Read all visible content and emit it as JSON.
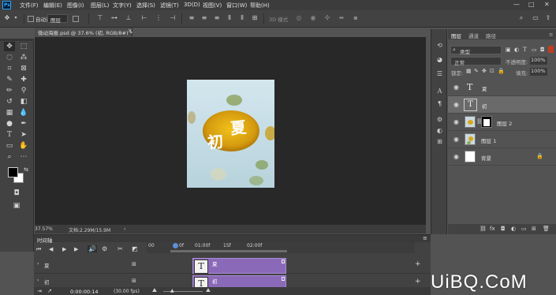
{
  "app": {
    "logo": "Ps"
  },
  "menu": [
    "文件(F)",
    "编辑(E)",
    "图像(I)",
    "图层(L)",
    "文字(Y)",
    "选择(S)",
    "滤镜(T)",
    "3D(D)",
    "视图(V)",
    "窗口(W)",
    "帮助(H)"
  ],
  "window_controls": {
    "minimize": "—",
    "maximize": "□",
    "close": "✕"
  },
  "options_bar": {
    "auto_select_label": "自动选择",
    "auto_select_value": "图层",
    "mode_3d": "3D 模式"
  },
  "document": {
    "tab_title": "微动海报.psd @ 37.6% (初, RGB/8#) *",
    "close_glyph": "×",
    "zoom": "37.57%",
    "doc_size": "文档:2.29M/15.9M"
  },
  "artwork": {
    "text_xia": "夏",
    "text_chu": "初"
  },
  "panels": {
    "tabs": [
      "图层",
      "通道",
      "路径"
    ],
    "filter_kind": "类型",
    "blend_mode": "正常",
    "opacity_label": "不透明度:",
    "opacity_value": "100%",
    "lock_label": "锁定:",
    "fill_label": "填充:",
    "fill_value": "100%",
    "layers": [
      {
        "name": "夏",
        "kind": "text",
        "selected": false
      },
      {
        "name": "初",
        "kind": "text",
        "selected": true
      },
      {
        "name": "图层 2",
        "kind": "masked",
        "selected": false
      },
      {
        "name": "图层 1",
        "kind": "image",
        "selected": false
      },
      {
        "name": "背景",
        "kind": "background",
        "selected": false
      }
    ]
  },
  "timeline": {
    "title": "时间轴",
    "ruler_labels": [
      "00",
      "01:00f",
      "15f",
      "02:00f"
    ],
    "playhead_label": "0f",
    "tracks": [
      {
        "label": "夏",
        "clip_label": "夏"
      },
      {
        "label": "初",
        "clip_label": "初"
      }
    ],
    "current_time": "0:00:00:14",
    "fps": "(30.00 fps)"
  },
  "watermark": {
    "text": "UiBQ.CoM"
  }
}
